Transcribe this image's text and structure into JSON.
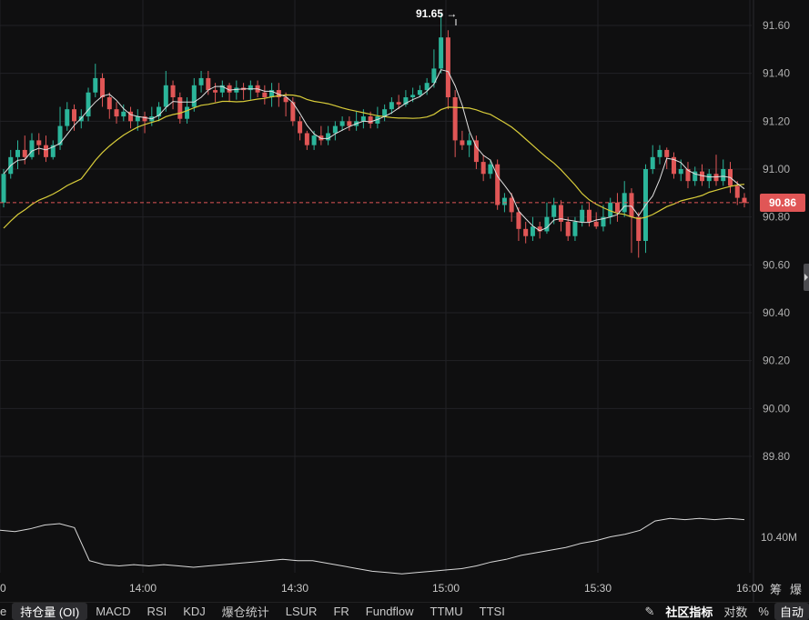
{
  "chart_data": {
    "type": "candlestick",
    "price_axis": {
      "ticks": [
        "91.60",
        "91.40",
        "91.20",
        "91.00",
        "90.80",
        "90.60",
        "90.40",
        "90.20",
        "90.00",
        "89.80"
      ],
      "ylim": [
        89.7,
        91.7
      ]
    },
    "time_axis": {
      "ticks": [
        "0",
        "14:00",
        "14:30",
        "15:00",
        "15:30",
        "16:00"
      ]
    },
    "current_price": "90.86",
    "high_marker": "91.65 →",
    "lower_panel": {
      "indicator": "持仓量 (OI)",
      "label": "10.40M",
      "values": [
        10.29,
        10.28,
        10.3,
        10.33,
        10.34,
        10.31,
        10.06,
        10.03,
        10.02,
        10.03,
        10.02,
        10.03,
        10.02,
        10.01,
        10.02,
        10.03,
        10.04,
        10.05,
        10.06,
        10.07,
        10.06,
        10.06,
        10.04,
        10.02,
        10.0,
        9.98,
        9.97,
        9.96,
        9.97,
        9.98,
        9.99,
        10.0,
        10.02,
        10.05,
        10.07,
        10.1,
        10.12,
        10.14,
        10.16,
        10.19,
        10.21,
        10.24,
        10.26,
        10.29,
        10.36,
        10.38,
        10.37,
        10.38,
        10.37,
        10.38,
        10.37
      ]
    },
    "candles": [
      [
        90.86,
        90.98,
        90.84,
        91.0
      ],
      [
        90.98,
        91.05,
        90.96,
        91.08
      ],
      [
        91.05,
        91.08,
        91.0,
        91.12
      ],
      [
        91.08,
        91.05,
        91.02,
        91.14
      ],
      [
        91.05,
        91.12,
        91.04,
        91.15
      ],
      [
        91.12,
        91.1,
        91.06,
        91.15
      ],
      [
        91.1,
        91.05,
        91.03,
        91.14
      ],
      [
        91.05,
        91.1,
        91.04,
        91.12
      ],
      [
        91.1,
        91.18,
        91.08,
        91.26
      ],
      [
        91.18,
        91.25,
        91.16,
        91.28
      ],
      [
        91.25,
        91.2,
        91.16,
        91.27
      ],
      [
        91.2,
        91.22,
        91.17,
        91.25
      ],
      [
        91.22,
        91.32,
        91.2,
        91.34
      ],
      [
        91.32,
        91.38,
        91.3,
        91.44
      ],
      [
        91.38,
        91.3,
        91.26,
        91.4
      ],
      [
        91.3,
        91.25,
        91.21,
        91.32
      ],
      [
        91.25,
        91.22,
        91.19,
        91.28
      ],
      [
        91.22,
        91.24,
        91.2,
        91.27
      ],
      [
        91.24,
        91.2,
        91.17,
        91.26
      ],
      [
        91.2,
        91.22,
        91.16,
        91.25
      ],
      [
        91.22,
        91.2,
        91.15,
        91.24
      ],
      [
        91.2,
        91.22,
        91.18,
        91.26
      ],
      [
        91.22,
        91.26,
        91.2,
        91.28
      ],
      [
        91.26,
        91.35,
        91.24,
        91.41
      ],
      [
        91.35,
        91.3,
        91.25,
        91.37
      ],
      [
        91.3,
        91.21,
        91.19,
        91.32
      ],
      [
        91.21,
        91.26,
        91.19,
        91.3
      ],
      [
        91.26,
        91.35,
        91.24,
        91.38
      ],
      [
        91.35,
        91.38,
        91.32,
        91.41
      ],
      [
        91.38,
        91.33,
        91.31,
        91.41
      ],
      [
        91.33,
        91.32,
        91.28,
        91.36
      ],
      [
        91.32,
        91.35,
        91.3,
        91.37
      ],
      [
        91.35,
        91.32,
        91.28,
        91.36
      ],
      [
        91.32,
        91.34,
        91.29,
        91.37
      ],
      [
        91.34,
        91.33,
        91.29,
        91.36
      ],
      [
        91.33,
        91.35,
        91.29,
        91.37
      ],
      [
        91.35,
        91.32,
        91.3,
        91.37
      ],
      [
        91.32,
        91.3,
        91.27,
        91.35
      ],
      [
        91.3,
        91.33,
        91.26,
        91.36
      ],
      [
        91.33,
        91.3,
        91.26,
        91.36
      ],
      [
        91.3,
        91.28,
        91.22,
        91.32
      ],
      [
        91.28,
        91.2,
        91.18,
        91.3
      ],
      [
        91.2,
        91.15,
        91.12,
        91.22
      ],
      [
        91.15,
        91.1,
        91.08,
        91.16
      ],
      [
        91.1,
        91.14,
        91.08,
        91.16
      ],
      [
        91.14,
        91.12,
        91.1,
        91.18
      ],
      [
        91.12,
        91.15,
        91.1,
        91.18
      ],
      [
        91.15,
        91.18,
        91.12,
        91.2
      ],
      [
        91.18,
        91.2,
        91.16,
        91.22
      ],
      [
        91.2,
        91.18,
        91.16,
        91.22
      ],
      [
        91.18,
        91.2,
        91.16,
        91.24
      ],
      [
        91.2,
        91.22,
        91.17,
        91.25
      ],
      [
        91.22,
        91.19,
        91.17,
        91.24
      ],
      [
        91.19,
        91.22,
        91.17,
        91.26
      ],
      [
        91.22,
        91.25,
        91.2,
        91.27
      ],
      [
        91.25,
        91.28,
        91.23,
        91.3
      ],
      [
        91.28,
        91.27,
        91.25,
        91.31
      ],
      [
        91.27,
        91.3,
        91.26,
        91.33
      ],
      [
        91.3,
        91.31,
        91.28,
        91.34
      ],
      [
        91.31,
        91.33,
        91.3,
        91.35
      ],
      [
        91.33,
        91.36,
        91.31,
        91.38
      ],
      [
        91.36,
        91.42,
        91.34,
        91.5
      ],
      [
        91.42,
        91.55,
        91.4,
        91.65
      ],
      [
        91.55,
        91.3,
        91.25,
        91.58
      ],
      [
        91.3,
        91.12,
        91.05,
        91.33
      ],
      [
        91.12,
        91.1,
        91.08,
        91.16
      ],
      [
        91.1,
        91.12,
        91.05,
        91.15
      ],
      [
        91.12,
        91.03,
        91.0,
        91.14
      ],
      [
        91.03,
        90.98,
        90.95,
        91.06
      ],
      [
        90.98,
        91.02,
        90.96,
        91.04
      ],
      [
        91.02,
        90.85,
        90.83,
        91.04
      ],
      [
        90.85,
        90.88,
        90.82,
        90.9
      ],
      [
        90.88,
        90.82,
        90.78,
        90.9
      ],
      [
        90.82,
        90.75,
        90.7,
        90.84
      ],
      [
        90.75,
        90.72,
        90.69,
        90.78
      ],
      [
        90.72,
        90.76,
        90.7,
        90.8
      ],
      [
        90.76,
        90.74,
        90.71,
        90.78
      ],
      [
        90.74,
        90.8,
        90.73,
        90.86
      ],
      [
        90.8,
        90.85,
        90.77,
        90.88
      ],
      [
        90.85,
        90.78,
        90.74,
        90.87
      ],
      [
        90.78,
        90.72,
        90.7,
        90.8
      ],
      [
        90.72,
        90.78,
        90.7,
        90.8
      ],
      [
        90.78,
        90.83,
        90.76,
        90.85
      ],
      [
        90.83,
        90.78,
        90.76,
        90.86
      ],
      [
        90.78,
        90.76,
        90.75,
        90.82
      ],
      [
        90.76,
        90.8,
        90.74,
        90.85
      ],
      [
        90.8,
        90.86,
        90.77,
        90.88
      ],
      [
        90.86,
        90.82,
        90.78,
        90.9
      ],
      [
        90.82,
        90.9,
        90.8,
        90.95
      ],
      [
        90.9,
        90.8,
        90.65,
        90.92
      ],
      [
        90.8,
        90.7,
        90.63,
        90.82
      ],
      [
        90.7,
        91.0,
        90.65,
        91.02
      ],
      [
        91.0,
        91.05,
        90.98,
        91.1
      ],
      [
        91.05,
        91.08,
        91.02,
        91.1
      ],
      [
        91.08,
        91.05,
        91.0,
        91.09
      ],
      [
        91.05,
        90.98,
        90.96,
        91.07
      ],
      [
        90.98,
        91.0,
        90.95,
        91.04
      ],
      [
        91.0,
        90.95,
        90.92,
        91.03
      ],
      [
        90.95,
        90.99,
        90.93,
        91.01
      ],
      [
        90.99,
        90.95,
        90.93,
        91.02
      ],
      [
        90.95,
        90.98,
        90.92,
        91.0
      ],
      [
        90.98,
        90.95,
        90.93,
        91.06
      ],
      [
        90.95,
        91.0,
        90.93,
        91.04
      ],
      [
        91.0,
        90.93,
        90.9,
        91.03
      ],
      [
        90.93,
        90.88,
        90.85,
        90.95
      ],
      [
        90.88,
        90.86,
        90.84,
        90.9
      ]
    ]
  },
  "toolbar": {
    "items": [
      "e",
      "持仓量 (OI)",
      "MACD",
      "RSI",
      "KDJ",
      "爆仓统计",
      "LSUR",
      "FR",
      "Fundflow",
      "TTMU",
      "TTSI"
    ],
    "right": [
      "社区指标",
      "对数",
      "%",
      "自动"
    ]
  },
  "corner": {
    "a": "筹",
    "b": "爆"
  },
  "colors": {
    "up": "#2bb59a",
    "down": "#e05656",
    "ma_fast": "#e0e0e0",
    "ma_slow": "#d8cc3a",
    "grid": "#222226"
  }
}
